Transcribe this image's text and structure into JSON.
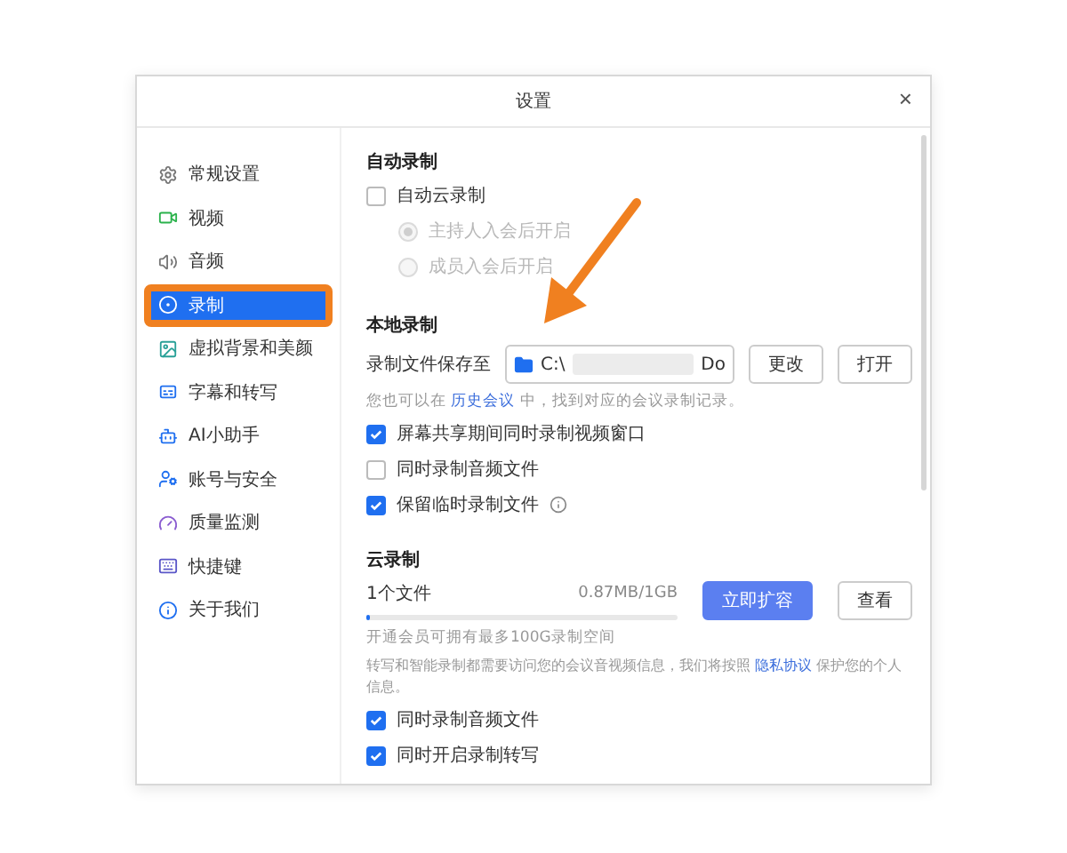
{
  "window": {
    "title": "设置",
    "close": "×"
  },
  "sidebar": {
    "items": [
      {
        "label": "常规设置",
        "selected": false
      },
      {
        "label": "视频",
        "selected": false
      },
      {
        "label": "音频",
        "selected": false
      },
      {
        "label": "录制",
        "selected": true,
        "highlighted": true
      },
      {
        "label": "虚拟背景和美颜",
        "selected": false
      },
      {
        "label": "字幕和转写",
        "selected": false
      },
      {
        "label": "AI小助手",
        "selected": false
      },
      {
        "label": "账号与安全",
        "selected": false
      },
      {
        "label": "质量监测",
        "selected": false
      },
      {
        "label": "快捷键",
        "selected": false
      },
      {
        "label": "关于我们",
        "selected": false
      }
    ]
  },
  "auto_recording": {
    "title": "自动录制",
    "checkbox": {
      "label": "自动云录制",
      "checked": false
    },
    "options": [
      {
        "label": "主持人入会后开启",
        "selected": true,
        "disabled": true
      },
      {
        "label": "成员入会后开启",
        "selected": false,
        "disabled": true
      }
    ]
  },
  "local_recording": {
    "title": "本地录制",
    "path_label": "录制文件保存至",
    "path_start": "C:\\",
    "path_end": "Do",
    "buttons": [
      "更改",
      "打开"
    ],
    "hint": {
      "before": "您也可以在",
      "link": "历史会议",
      "after": "中，找到对应的会议录制记录。"
    },
    "options": [
      {
        "label": "屏幕共享期间同时录制视频窗口",
        "checked": true,
        "info": false
      },
      {
        "label": "同时录制音频文件",
        "checked": false,
        "info": false
      },
      {
        "label": "保留临时录制文件",
        "checked": true,
        "info": true
      }
    ]
  },
  "cloud_recording": {
    "title": "云录制",
    "files": "1个文件",
    "usage": "0.87MB/1GB",
    "level": 0.01,
    "primary_button": "立即扩容",
    "secondary_button": "查看",
    "note": "开通会员可拥有最多100G录制空间",
    "privacy": {
      "before": "转写和智能录制都需要访问您的会议音视频信息，我们将按照",
      "link": "隐私协议",
      "after": "保护您的个人信息。"
    },
    "options": [
      {
        "label": "同时录制音频文件",
        "checked": true
      },
      {
        "label": "同时开启录制转写",
        "checked": true
      }
    ]
  }
}
